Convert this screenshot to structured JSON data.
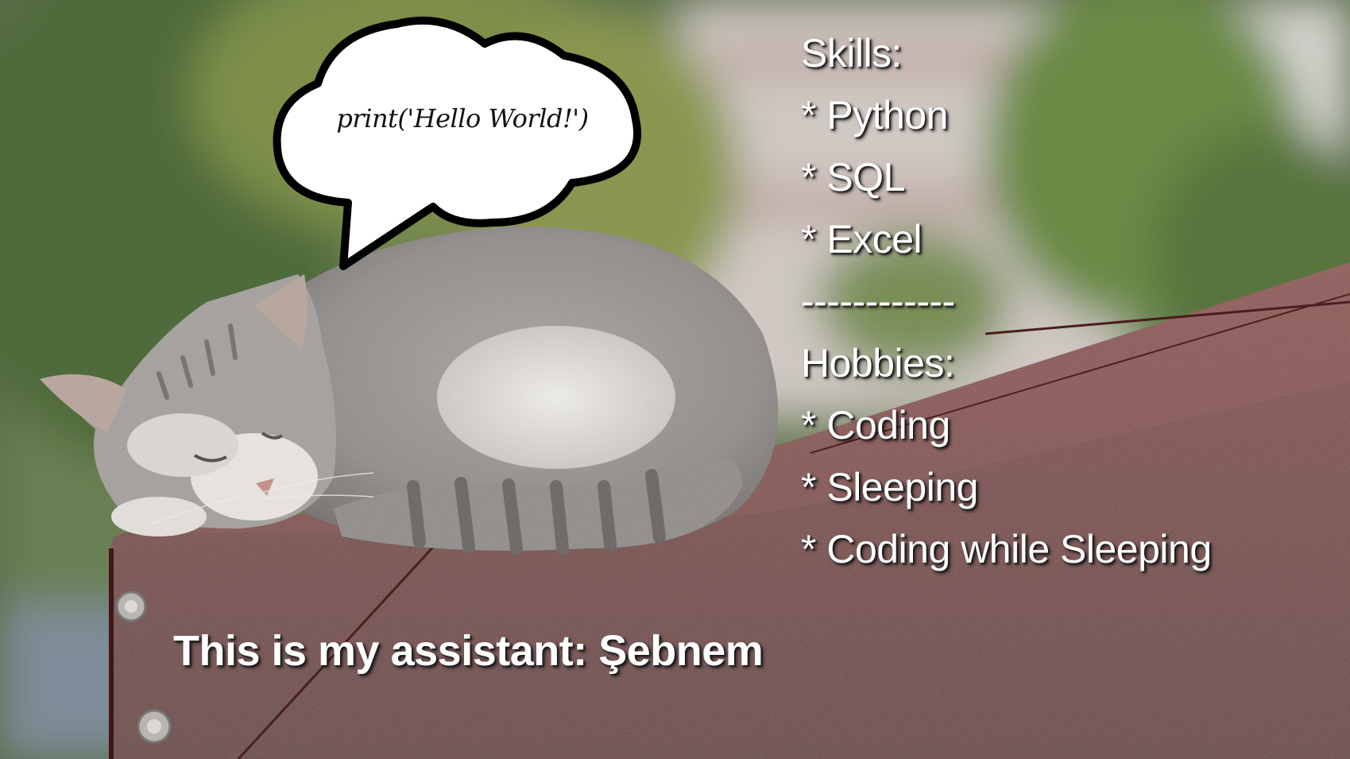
{
  "image": {
    "subject": "sleeping grey and white cat on a red roof ledge",
    "background_colors": {
      "foliage": "#5d7a45",
      "building": "#c9c2bd",
      "roof": "#7a3a36",
      "sky": "#d8d8d5"
    }
  },
  "speech_bubble": {
    "text": "print('Hello World!')"
  },
  "profile": {
    "lines": [
      "Skills:",
      "* Python",
      "* SQL",
      "* Excel",
      "------------",
      "Hobbies:",
      "* Coding",
      "* Sleeping",
      "* Coding while Sleeping"
    ]
  },
  "caption": {
    "text": "This is my assistant: Şebnem"
  }
}
